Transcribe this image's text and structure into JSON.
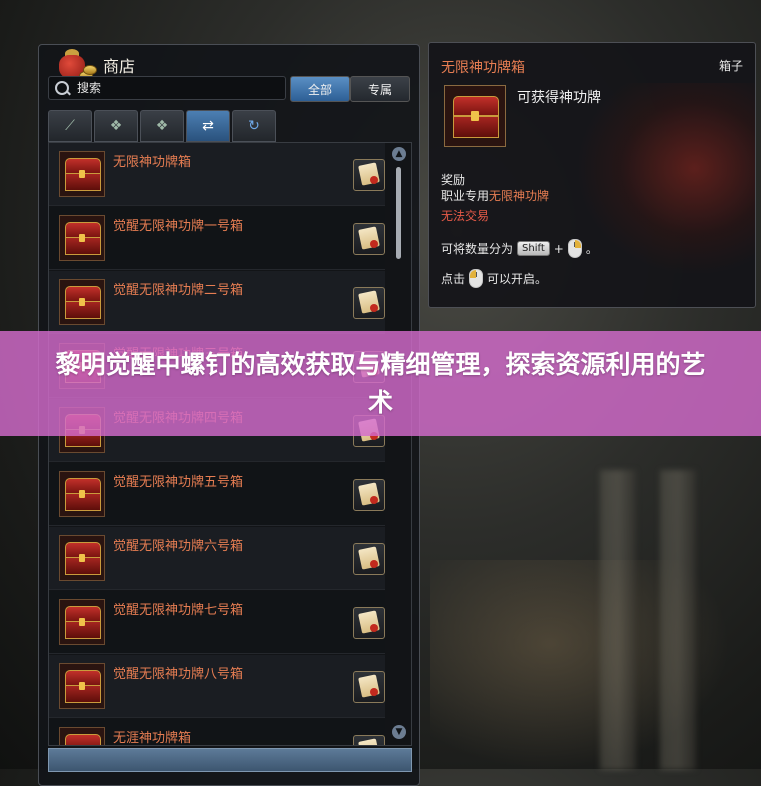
{
  "shop": {
    "title": "商店",
    "search_placeholder": "搜索",
    "filter_all": "全部",
    "filter_exclusive": "专属",
    "tabs": [
      {
        "icon": "sword-icon",
        "glyph": "⟋"
      },
      {
        "icon": "gem-icon",
        "glyph": "❖"
      },
      {
        "icon": "gem-icon",
        "glyph": "❖"
      },
      {
        "icon": "swap-arrows-icon",
        "glyph": "⇄"
      },
      {
        "icon": "refresh-icon",
        "glyph": "↻"
      }
    ],
    "items": [
      {
        "name": "无限神功牌箱"
      },
      {
        "name": "觉醒无限神功牌一号箱"
      },
      {
        "name": "觉醒无限神功牌二号箱"
      },
      {
        "name": "觉醒无限神功牌三号箱"
      },
      {
        "name": "觉醒无限神功牌四号箱"
      },
      {
        "name": "觉醒无限神功牌五号箱"
      },
      {
        "name": "觉醒无限神功牌六号箱"
      },
      {
        "name": "觉醒无限神功牌七号箱"
      },
      {
        "name": "觉醒无限神功牌八号箱"
      },
      {
        "name": "无涯神功牌箱"
      }
    ],
    "scroll_up": "▲",
    "scroll_down": "▼"
  },
  "tooltip": {
    "title": "无限神功牌箱",
    "type": "箱子",
    "description": "可获得神功牌",
    "reward_heading": "奖励",
    "reward_prefix": "职业专用",
    "reward_item": "无限神功牌",
    "untradable": "无法交易",
    "split_text": "可将数量分为",
    "shift_key": "Shift",
    "plus": "+",
    "period": "。",
    "open_prefix": "点击",
    "open_suffix": "可以开启。"
  },
  "banner": {
    "text": "黎明觉醒中螺钉的高效获取与精细管理，探索资源利用的艺术"
  },
  "colors": {
    "item_name": "#e67d52",
    "banner_bg": "#d36bcc",
    "active_tab": "#4c7fb3",
    "untradable": "#e65a48"
  }
}
